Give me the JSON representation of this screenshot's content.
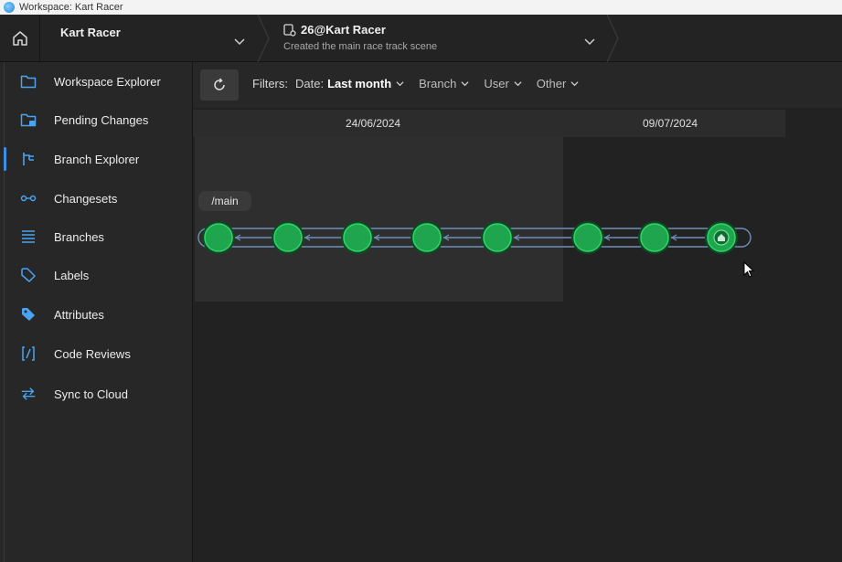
{
  "window": {
    "title": "Workspace: Kart Racer"
  },
  "topbar": {
    "workspace_name": "Kart Racer",
    "changeset_title": "26@Kart Racer",
    "changeset_subtitle": "Created the main race track scene"
  },
  "sidebar": {
    "items": [
      {
        "label": "Workspace Explorer",
        "icon": "folder-icon"
      },
      {
        "label": "Pending Changes",
        "icon": "pending-changes-icon"
      },
      {
        "label": "Branch Explorer",
        "icon": "branch-icon",
        "active": true
      },
      {
        "label": "Changesets",
        "icon": "changeset-icon"
      },
      {
        "label": "Branches",
        "icon": "list-icon"
      },
      {
        "label": "Labels",
        "icon": "label-icon"
      },
      {
        "label": "Attributes",
        "icon": "attribute-tag-icon"
      },
      {
        "label": "Code Reviews",
        "icon": "code-review-icon"
      },
      {
        "label": "Sync to Cloud",
        "icon": "sync-icon"
      }
    ]
  },
  "toolbar": {
    "filters_label": "Filters:",
    "date_label": "Date:",
    "date_value": "Last month",
    "branch_label": "Branch",
    "user_label": "User",
    "other_label": "Other"
  },
  "timeline": {
    "dates": [
      "24/06/2024",
      "09/07/2024"
    ]
  },
  "branch": {
    "name": "/main",
    "changeset_count": 8,
    "head_index": 7
  },
  "colors": {
    "accent": "#3c8fe0",
    "node_green": "#1fa54d",
    "branch_line": "#6f8fb8"
  }
}
